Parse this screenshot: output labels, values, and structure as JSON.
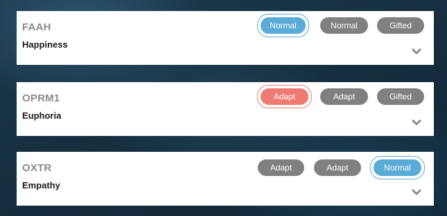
{
  "cards": [
    {
      "title": "FAAH",
      "subtitle": "Happiness",
      "options": [
        "Normal",
        "Normal",
        "Gifted"
      ],
      "selected_index": 0,
      "selected_color": "#5aabd6"
    },
    {
      "title": "OPRM1",
      "subtitle": "Euphoria",
      "options": [
        "Adapt",
        "Adapt",
        "Gifted"
      ],
      "selected_index": 0,
      "selected_color": "#ef7a72"
    },
    {
      "title": "OXTR",
      "subtitle": "Empathy",
      "options": [
        "Adapt",
        "Adapt",
        "Normal"
      ],
      "selected_index": 2,
      "selected_color": "#5aabd6"
    }
  ],
  "colors": {
    "unselected": "#808080",
    "blue": "#5aabd6",
    "red": "#ef7a72"
  },
  "icons": {
    "expand": "chevron-down-icon"
  }
}
